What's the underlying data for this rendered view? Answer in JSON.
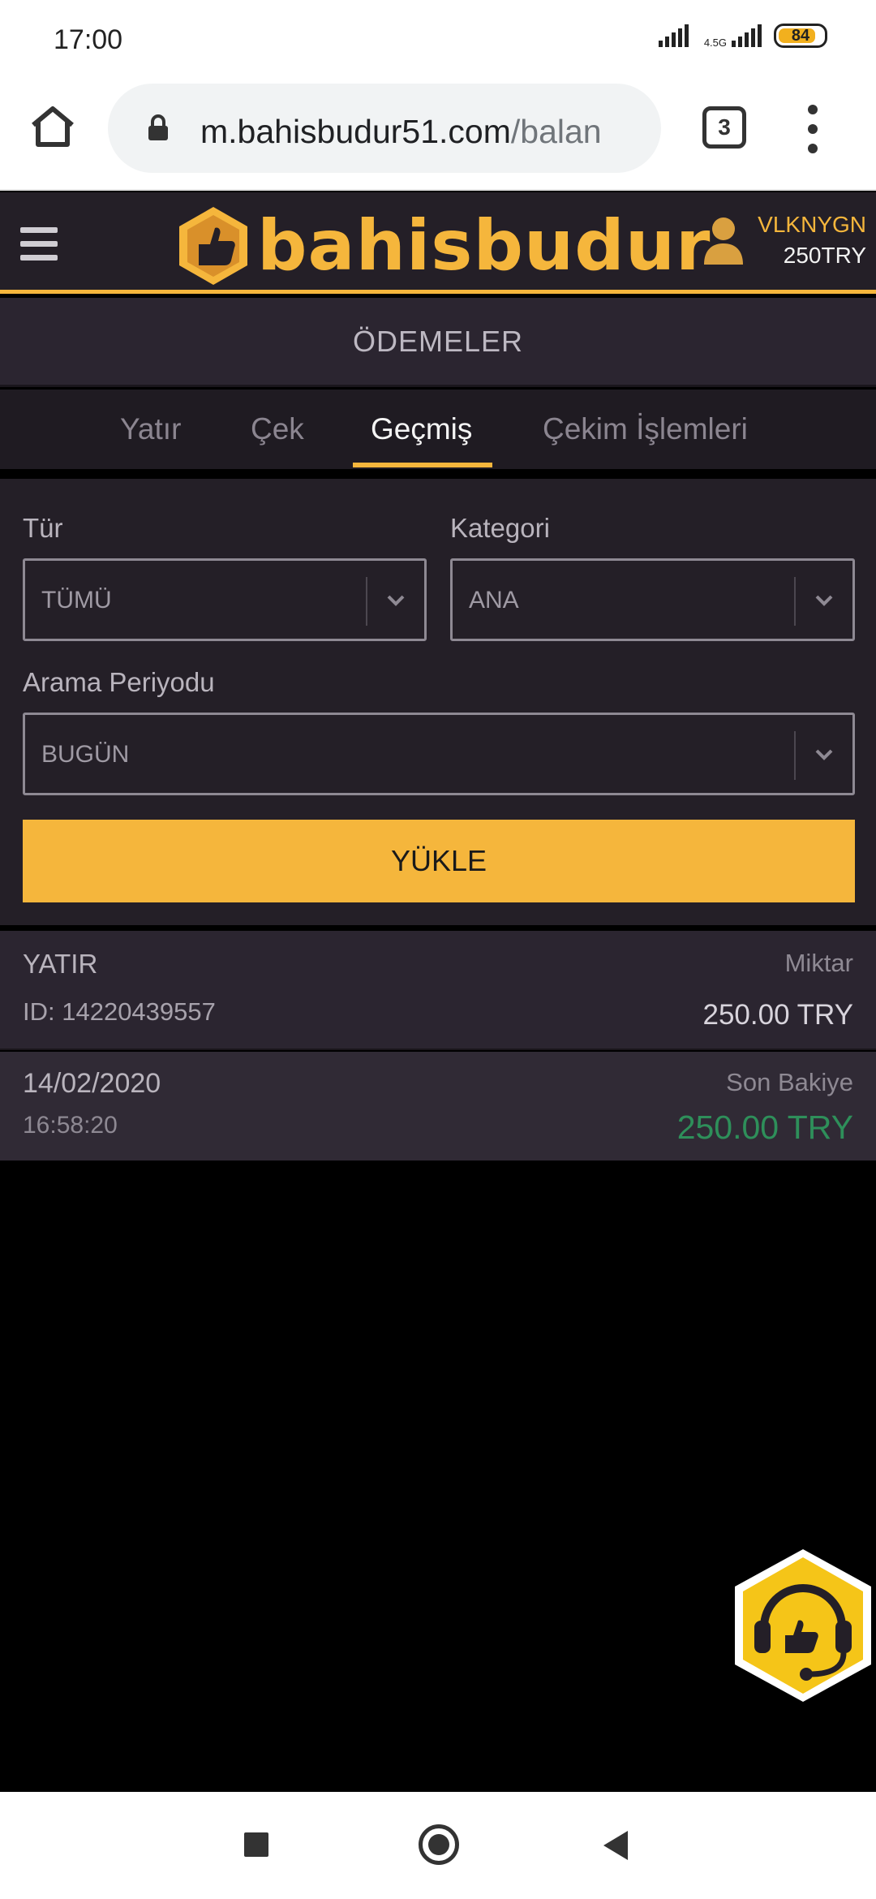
{
  "status_bar": {
    "time": "17:00",
    "network": "4.5G",
    "battery": "84",
    "battery_level": 0.84
  },
  "browser": {
    "url_host": "m.bahisbudur51.com",
    "url_path": "/balan",
    "tab_count": "3"
  },
  "header": {
    "logo_text": "bahisbudur",
    "username": "VLKNYGN",
    "balance": "250TRY"
  },
  "page": {
    "title": "ÖDEMELER"
  },
  "tabs": [
    {
      "label": "Yatır",
      "active": false
    },
    {
      "label": "Çek",
      "active": false
    },
    {
      "label": "Geçmiş",
      "active": true
    },
    {
      "label": "Çekim İşlemleri",
      "active": false
    }
  ],
  "filters": {
    "type_label": "Tür",
    "type_value": "TÜMÜ",
    "category_label": "Kategori",
    "category_value": "ANA",
    "period_label": "Arama Periyodu",
    "period_value": "BUGÜN",
    "load_button": "YÜKLE"
  },
  "transactions": [
    {
      "type": "YATIR",
      "id": "ID: 14220439557",
      "amount_label": "Miktar",
      "amount": "250.00 TRY",
      "date": "14/02/2020",
      "time": "16:58:20",
      "balance_label": "Son Bakiye",
      "balance": "250.00 TRY"
    }
  ],
  "colors": {
    "accent": "#f5b63c",
    "header_bg": "#241f27",
    "positive": "#2e8f5a"
  },
  "icons": {
    "home": "home-icon",
    "lock": "lock-icon",
    "menu": "more-vert-icon",
    "support": "headset-support-icon"
  }
}
